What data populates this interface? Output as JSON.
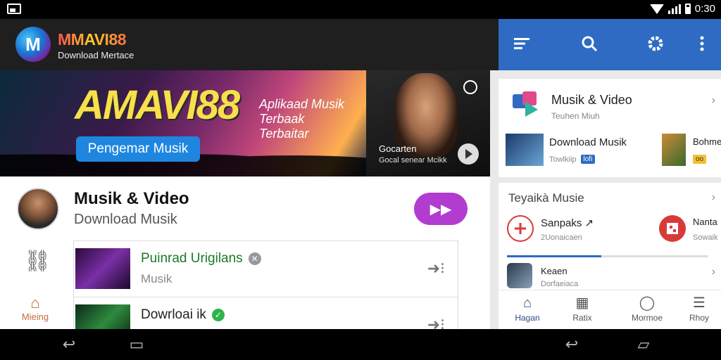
{
  "status_bar": {
    "time": "0:30"
  },
  "header": {
    "logo_letter": "M",
    "brand": "MMAVI88",
    "subtitle": "Download Mertace"
  },
  "right_header": {
    "icons": [
      "menu-icon",
      "search-icon",
      "gear-icon",
      "more-vert-icon"
    ]
  },
  "banner": {
    "headline": "AMAVI88",
    "tagline_1": "Aplikaad Musik",
    "tagline_2": "Terbaak",
    "tagline_3": "Terbaitar",
    "cta": "Pengemar Musik",
    "side_title": "Gocarten",
    "side_sub": "Gocal senear Mcikk"
  },
  "main": {
    "title": "Musik & Video",
    "subtitle": "Download Musik",
    "side_home_label": "Mieing",
    "list": [
      {
        "title": "Puinrad Urigilans",
        "subtitle": "Musik",
        "badge": "x"
      },
      {
        "title": "Dowrloai ik",
        "subtitle": "",
        "badge": "ok"
      }
    ]
  },
  "right_panel": {
    "card1": {
      "title": "Musik & Video",
      "subtitle": "Teuhen Miuh",
      "item1_title": "Download Musik",
      "item1_sub": "Towlkiip",
      "item1_chip": "lofi",
      "item2_title": "Bohme",
      "item2_chip": "oo"
    },
    "card2": {
      "title": "Teyaikà Musie",
      "item1_title": "Sanpaks ↗",
      "item1_sub": "2Uonaicaen",
      "item2_title": "Nanta",
      "item2_sub": "Sowaik",
      "item3_title": "Keaen",
      "item3_sub": "Dorfaeiaca",
      "progress": 0.47
    },
    "bottom_nav": [
      {
        "label": "Hagan",
        "icon": "home-icon"
      },
      {
        "label": "Ratix",
        "icon": "grid-icon"
      },
      {
        "label": "Mormoe",
        "icon": "comment-icon"
      },
      {
        "label": "Rhoy",
        "icon": "lines-icon"
      }
    ]
  },
  "colors": {
    "accent_blue": "#2f6bc3",
    "play_purple": "#b23ccf",
    "cta_blue": "#1f86e0",
    "list_green": "#1b7a25"
  }
}
